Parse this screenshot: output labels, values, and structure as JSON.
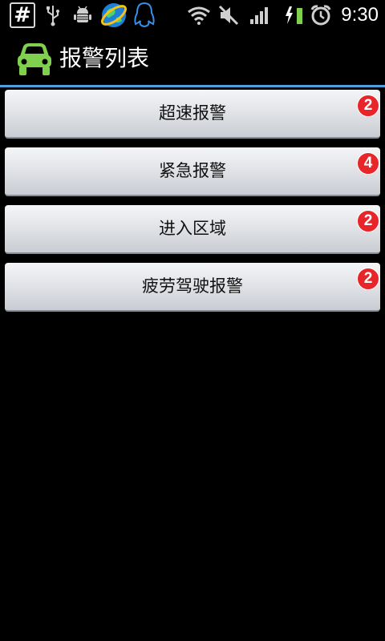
{
  "status_bar": {
    "icons": [
      "hash-icon",
      "usb-icon",
      "android-debug-icon",
      "browser-globe-icon",
      "qq-penguin-icon",
      "wifi-icon",
      "muted-speaker-icon",
      "signal-icon",
      "charging-battery-icon",
      "alarm-clock-icon"
    ],
    "time": "9:30"
  },
  "header": {
    "title": "报警列表",
    "icon": "car-icon",
    "accent_color": "#4aa3df"
  },
  "alarms": [
    {
      "label": "超速报警",
      "count": "2"
    },
    {
      "label": "紧急报警",
      "count": "4"
    },
    {
      "label": "进入区域",
      "count": "2"
    },
    {
      "label": "疲劳驾驶报警",
      "count": "2"
    }
  ],
  "colors": {
    "badge": "#e8262a",
    "car_icon": "#7fd04f"
  }
}
